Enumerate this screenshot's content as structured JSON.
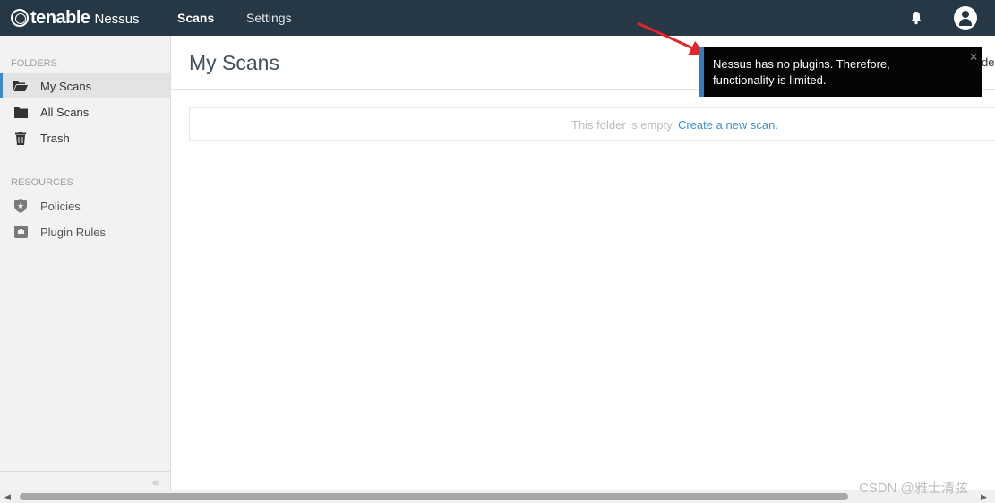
{
  "header": {
    "brand": "tenable",
    "product": "Nessus",
    "tabs": [
      {
        "label": "Scans"
      },
      {
        "label": "Settings"
      }
    ],
    "icons": [
      "bell-icon",
      "user-avatar-icon"
    ]
  },
  "sidebar": {
    "folders_label": "FOLDERS",
    "folders": [
      {
        "label": "My Scans",
        "icon": "folder-open-icon"
      },
      {
        "label": "All Scans",
        "icon": "folder-icon"
      },
      {
        "label": "Trash",
        "icon": "trash-icon"
      }
    ],
    "resources_label": "RESOURCES",
    "resources": [
      {
        "label": "Policies",
        "icon": "shield-icon"
      },
      {
        "label": "Plugin Rules",
        "icon": "plugin-rules-icon"
      }
    ],
    "collapse_label": "«"
  },
  "main": {
    "title": "My Scans",
    "empty_text": "This folder is empty.",
    "empty_link": "Create a new scan.",
    "cut_text": "de"
  },
  "notification": {
    "message": "Nessus has no plugins. Therefore, functionality is limited.",
    "close": "×",
    "accent": "#2f7fc0"
  },
  "scrollbar": {
    "left_arrow": "◀",
    "right_arrow": "▶"
  },
  "watermark": "CSDN @雅士清弦",
  "colors": {
    "topbar": "#263746",
    "link": "#3b93d1",
    "arrow": "#e0262b"
  }
}
